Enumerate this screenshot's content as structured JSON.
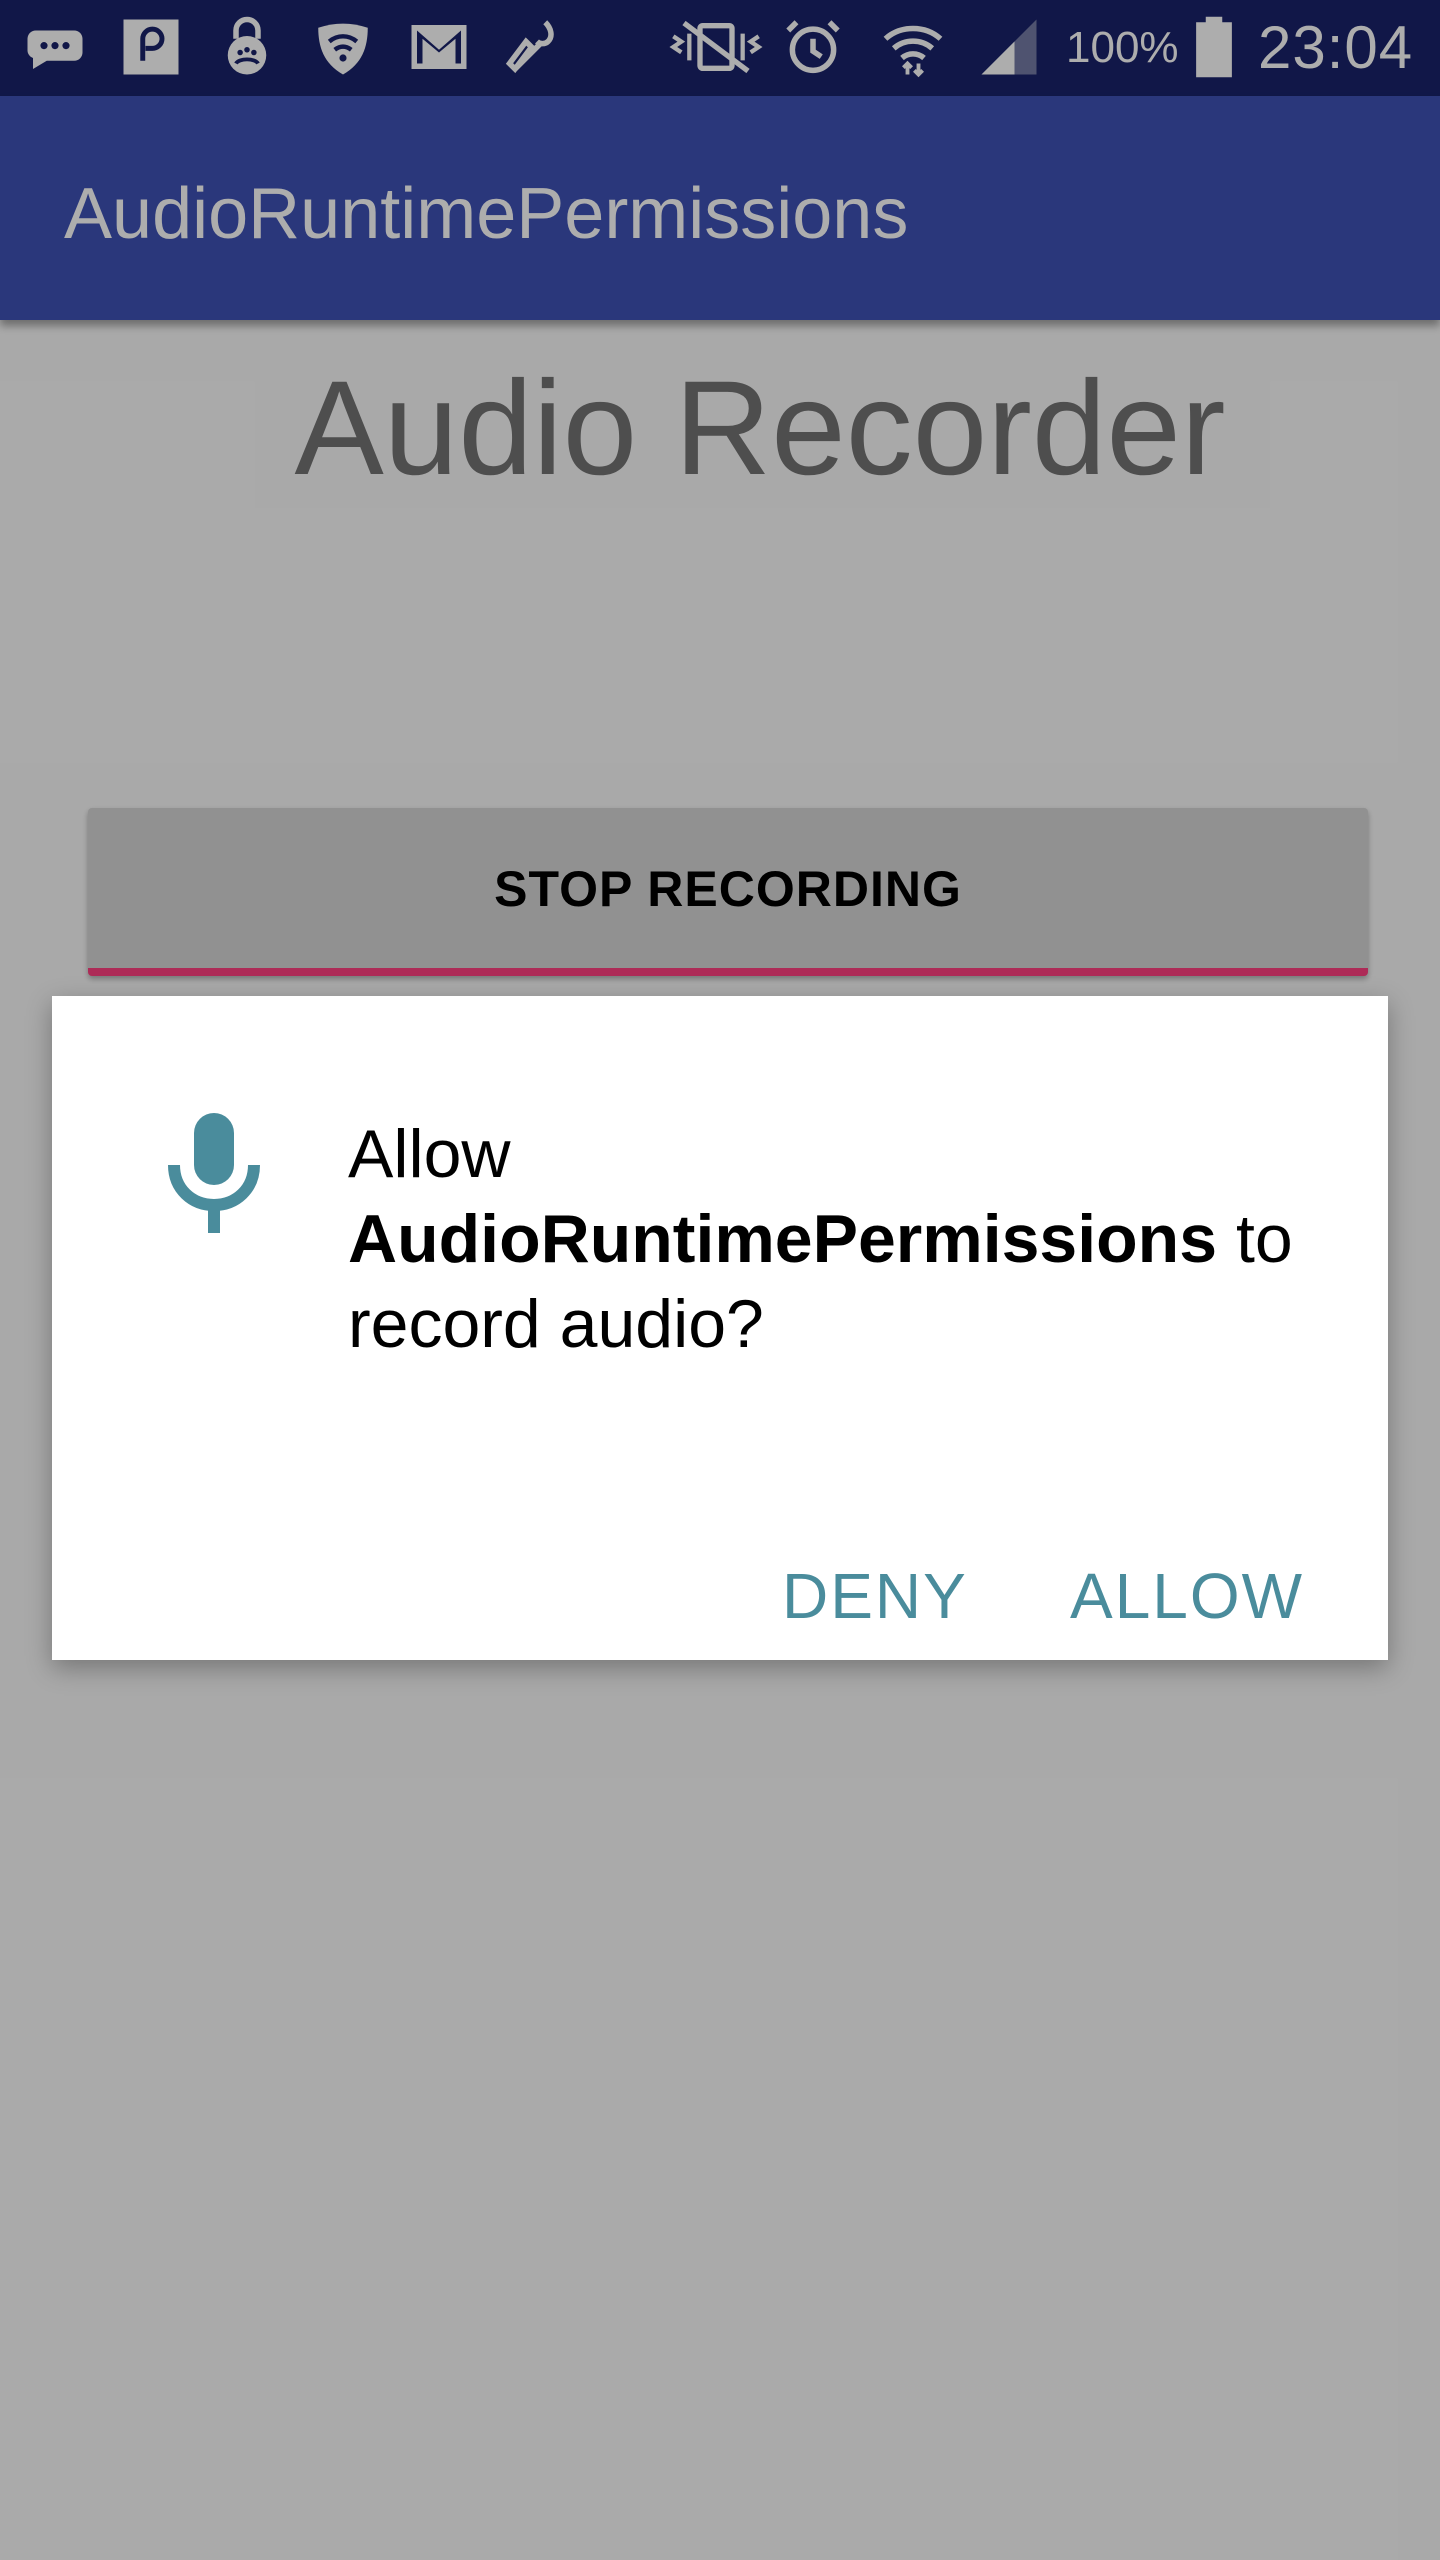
{
  "status_bar": {
    "icons": [
      "message-icon",
      "pocket-casts-icon",
      "vpn-lock-icon",
      "wifi-shield-icon",
      "gmail-icon",
      "tool-icon",
      "vibrate-mute-icon",
      "alarm-icon",
      "wifi-icon",
      "signal-icon",
      "battery-icon"
    ],
    "battery_percent": "100%",
    "time": "23:04"
  },
  "app_bar": {
    "title": "AudioRuntimePermissions"
  },
  "main": {
    "heading": "Audio Recorder",
    "stop_button_label": "STOP RECORDING"
  },
  "dialog": {
    "icon": "microphone-icon",
    "message_prefix": "Allow",
    "app_name": "AudioRuntimePermissions",
    "message_suffix": "to record audio?",
    "deny_label": "DENY",
    "allow_label": "ALLOW"
  },
  "colors": {
    "status_bar": "#1a236b",
    "app_bar": "#3f51b5",
    "accent": "#ff4081",
    "dialog_button": "#4a8c9c",
    "mic_icon": "#4a8c9c"
  }
}
